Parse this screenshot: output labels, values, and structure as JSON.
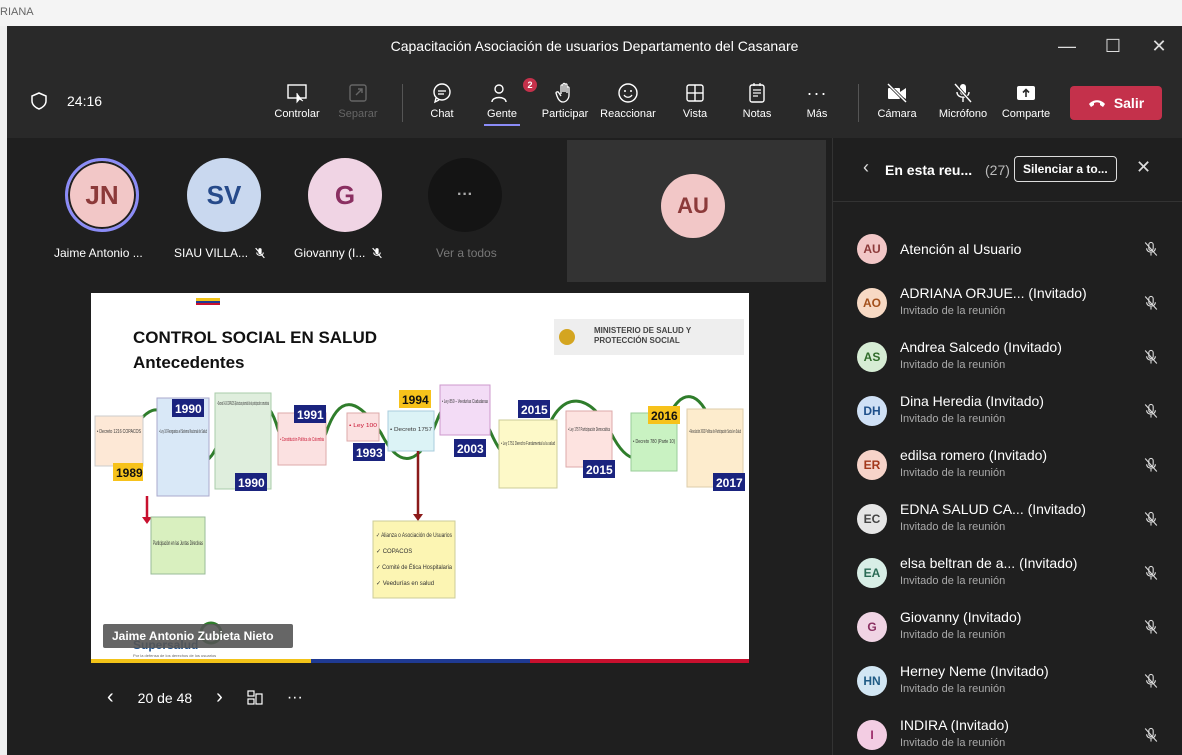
{
  "background": {
    "corner_text": "RIANA"
  },
  "window": {
    "title": "Capacitación Asociación de usuarios Departamento del Casanare"
  },
  "toolbar": {
    "timer": "24:16",
    "items": [
      {
        "label": "Controlar",
        "icon": "share-control-icon"
      },
      {
        "label": "Separar",
        "icon": "pop-out-icon"
      },
      {
        "label": "Chat",
        "icon": "chat-icon"
      },
      {
        "label": "Gente",
        "icon": "people-icon",
        "badge": "2"
      },
      {
        "label": "Participar",
        "icon": "raise-hand-icon"
      },
      {
        "label": "Reaccionar",
        "icon": "smiley-icon"
      },
      {
        "label": "Vista",
        "icon": "grid-view-icon"
      },
      {
        "label": "Notas",
        "icon": "notes-icon"
      },
      {
        "label": "Más",
        "icon": "more-icon"
      },
      {
        "label": "Cámara",
        "icon": "camera-off-icon"
      },
      {
        "label": "Micrófono",
        "icon": "mic-off-icon"
      },
      {
        "label": "Comparte",
        "icon": "share-icon"
      }
    ],
    "leave_label": "Salir"
  },
  "stage": {
    "participants": [
      {
        "initials": "JN",
        "name": "Jaime Antonio ...",
        "bg": "#f2c7c7",
        "fg": "#8c3a3a",
        "speaking": true
      },
      {
        "initials": "SV",
        "name": "SIAU VILLA...",
        "bg": "#c9d8ef",
        "fg": "#264a8a"
      },
      {
        "initials": "G",
        "name": "Giovanny (I...",
        "bg": "#f0d4e4",
        "fg": "#8a2f61"
      }
    ],
    "see_all_label": "Ver a todos",
    "tile_initials": "AU",
    "presenter_name": "Jaime Antonio Zubieta Nieto",
    "slide_counter": "20 de 48"
  },
  "slide": {
    "title1": "CONTROL SOCIAL EN SALUD",
    "title2": "Antecedentes",
    "ministry1": "MINISTERIO DE SALUD Y",
    "ministry2": "PROTECCIÓN SOCIAL",
    "years": [
      "1989",
      "1990",
      "1990",
      "1991",
      "1993",
      "1994",
      "2003",
      "2015",
      "2015",
      "2016",
      "2017"
    ],
    "boxes": [
      "• Decreto 1216 COPACOS",
      "• Ley 10 Reorganiza el Sistema Nacional de Salud",
      "• Decreto 1416 COPACOS (Estructura piramidal de la participación comunitaria",
      "• Constitución Política de Colombia",
      "• Ley 100",
      "• Decreto 1757",
      "• Ley 850 – Veedurías Ciudadanas",
      "• Ley 1751 Derecho Fundamental a la salud",
      "• Ley 1757 Participación Democrática",
      "• Decreto 780 (Parte 10)",
      "• Resolución 2063 Política de Participación Social en Salud"
    ],
    "note1": "Participación en las Juntas Directivas",
    "note2": [
      "✓ Alianza o Asociación de Usuarios",
      "✓ COPACOS",
      "✓ Comité de Ética Hospitalaria",
      "✓ Veedurías en salud"
    ],
    "footer_brand": "Supersalud",
    "footer_sub": "Por la defensa de los derechos de los usuarios"
  },
  "panel": {
    "title": "En esta reu...",
    "count": "(27)",
    "mute_all": "Silenciar a to...",
    "role": "Invitado de la reunión",
    "people": [
      {
        "initials": "AU",
        "name": "Atención al Usuario",
        "role": "",
        "bg": "#f2c7c7",
        "fg": "#8c3a3a"
      },
      {
        "initials": "AO",
        "name": "ADRIANA ORJUE... (Invitado)",
        "role": "Invitado de la reunión",
        "bg": "#f7d9c4",
        "fg": "#a3501b"
      },
      {
        "initials": "AS",
        "name": "Andrea Salcedo (Invitado)",
        "role": "Invitado de la reunión",
        "bg": "#d6ecd4",
        "fg": "#2f6b2a"
      },
      {
        "initials": "DH",
        "name": "Dina Heredia (Invitado)",
        "role": "Invitado de la reunión",
        "bg": "#cfe0f5",
        "fg": "#1e4f8a"
      },
      {
        "initials": "ER",
        "name": "edilsa romero (Invitado)",
        "role": "Invitado de la reunión",
        "bg": "#f6d3c9",
        "fg": "#a3381b"
      },
      {
        "initials": "EC",
        "name": "EDNA SALUD CA... (Invitado)",
        "role": "Invitado de la reunión",
        "bg": "#e6e6e6",
        "fg": "#444444"
      },
      {
        "initials": "EA",
        "name": "elsa beltran de a... (Invitado)",
        "role": "Invitado de la reunión",
        "bg": "#d8eee6",
        "fg": "#2a6b55"
      },
      {
        "initials": "G",
        "name": "Giovanny (Invitado)",
        "role": "Invitado de la reunión",
        "bg": "#f0d4e4",
        "fg": "#8a2f61"
      },
      {
        "initials": "HN",
        "name": "Herney Neme (Invitado)",
        "role": "Invitado de la reunión",
        "bg": "#d2e6f3",
        "fg": "#1f5b85"
      },
      {
        "initials": "I",
        "name": "INDIRA (Invitado)",
        "role": "Invitado de la reunión",
        "bg": "#f3cde3",
        "fg": "#9a2a68"
      }
    ]
  }
}
